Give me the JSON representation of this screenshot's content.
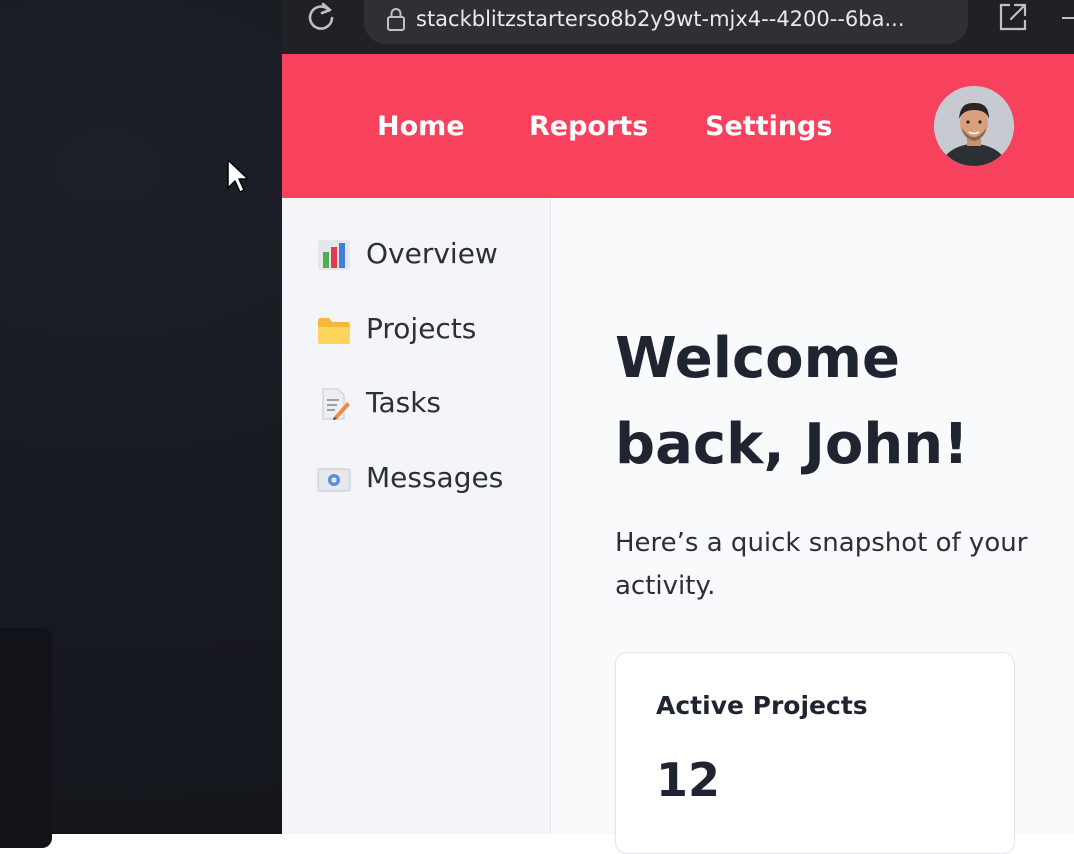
{
  "browser": {
    "url": "stackblitzstarterso8b2y9wt-mjx4--4200--6ba...",
    "icons": {
      "reload": "reload-icon",
      "lock": "lock-icon",
      "open_external": "open-in-new-window-icon",
      "minimize": "minimize-icon"
    }
  },
  "header": {
    "background_color": "#f8425d",
    "nav": [
      {
        "label": "Home"
      },
      {
        "label": "Reports"
      },
      {
        "label": "Settings"
      }
    ],
    "avatar_icon": "user-avatar"
  },
  "sidebar": {
    "items": [
      {
        "label": "Overview",
        "icon": "bar-chart-icon"
      },
      {
        "label": "Projects",
        "icon": "folder-icon"
      },
      {
        "label": "Tasks",
        "icon": "memo-icon"
      },
      {
        "label": "Messages",
        "icon": "envelope-icon"
      }
    ]
  },
  "main": {
    "title": "Welcome back, John!",
    "subtitle": "Here’s a quick snapshot of your activity.",
    "cards": [
      {
        "label": "Active Projects",
        "value": "12"
      }
    ]
  }
}
